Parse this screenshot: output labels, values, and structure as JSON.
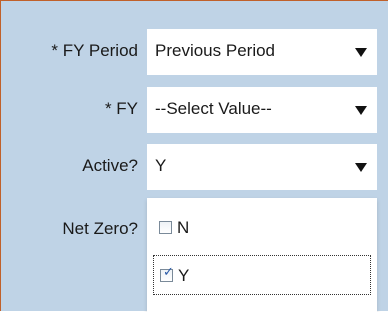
{
  "form": {
    "fields": [
      {
        "label": "* FY Period",
        "value": "Previous Period"
      },
      {
        "label": "* FY",
        "value": "--Select Value--"
      },
      {
        "label": "Active?",
        "value": "Y"
      },
      {
        "label": "Net Zero?"
      }
    ]
  },
  "dropdown": {
    "options": [
      {
        "label": "N",
        "checked": false
      },
      {
        "label": "Y",
        "checked": true
      }
    ]
  },
  "icons": {
    "dropdown_arrow": "triangle-down-icon",
    "checkbox": "checkbox-icon"
  },
  "colors": {
    "panel_bg": "#bfd3e6",
    "checkbox_check": "#2a5aa8"
  }
}
